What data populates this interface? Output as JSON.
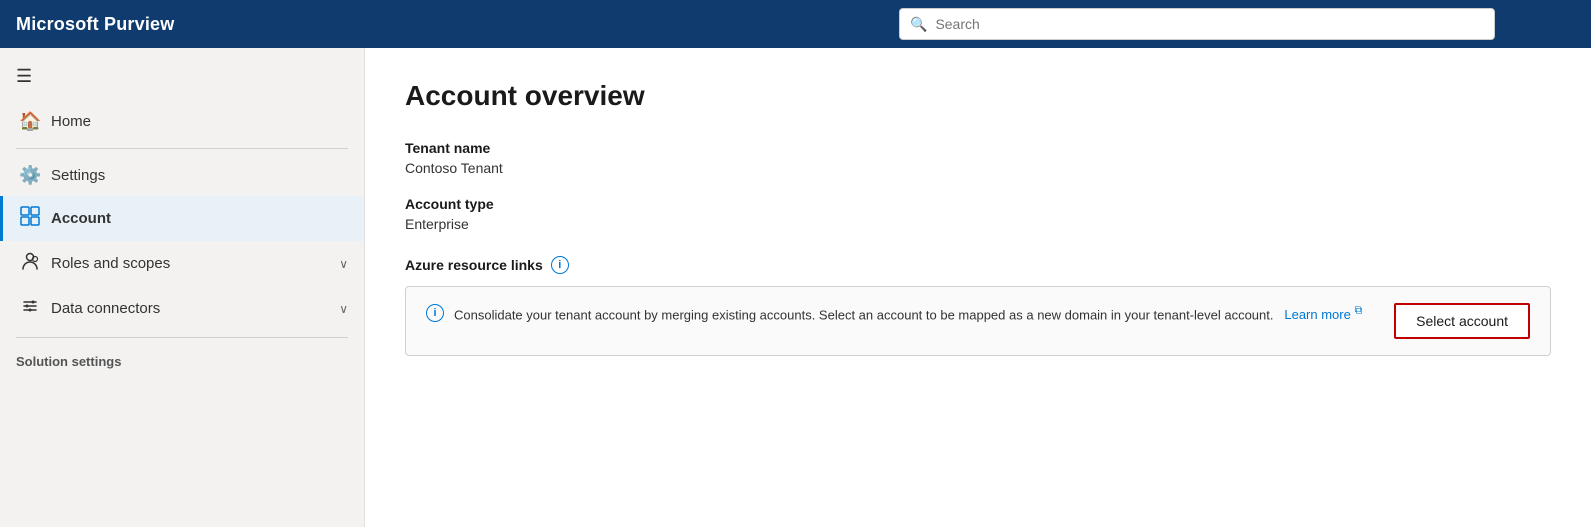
{
  "app": {
    "title": "Microsoft Purview"
  },
  "topbar": {
    "search_placeholder": "Search"
  },
  "sidebar": {
    "hamburger_label": "☰",
    "items": [
      {
        "id": "home",
        "label": "Home",
        "icon": "🏠",
        "active": false,
        "has_chevron": false
      },
      {
        "id": "settings",
        "label": "Settings",
        "icon": "⚙️",
        "active": false,
        "has_chevron": false
      },
      {
        "id": "account",
        "label": "Account",
        "icon": "▦",
        "active": true,
        "has_chevron": false
      },
      {
        "id": "roles-and-scopes",
        "label": "Roles and scopes",
        "icon": "⊞",
        "active": false,
        "has_chevron": true
      },
      {
        "id": "data-connectors",
        "label": "Data connectors",
        "icon": "⚡",
        "active": false,
        "has_chevron": true
      }
    ],
    "section_label": "Solution settings"
  },
  "main": {
    "page_title": "Account overview",
    "fields": [
      {
        "label": "Tenant name",
        "value": "Contoso Tenant"
      },
      {
        "label": "Account type",
        "value": "Enterprise"
      }
    ],
    "azure_resource_links": {
      "section_title": "Azure resource links",
      "info_text": "Consolidate your tenant account by merging existing accounts. Select an account to be mapped as a new domain in your tenant-level account.",
      "learn_more_label": "Learn more",
      "select_account_label": "Select account"
    }
  }
}
